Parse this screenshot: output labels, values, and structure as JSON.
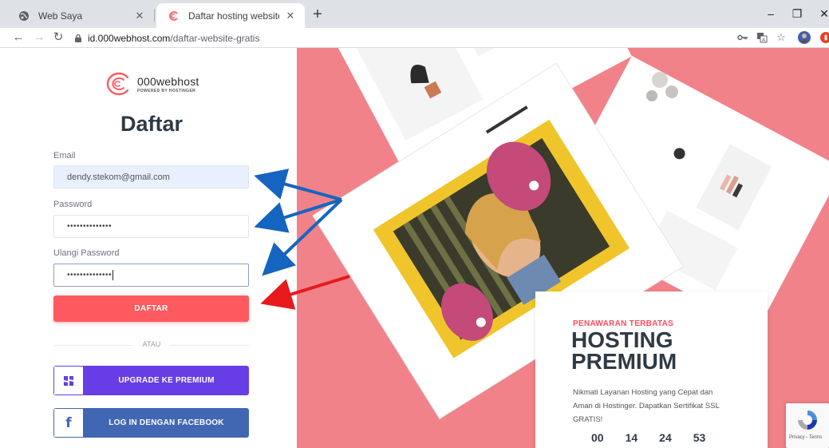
{
  "browser": {
    "tabs": [
      {
        "title": "Web Saya",
        "active": false
      },
      {
        "title": "Daftar hosting website gratis sek",
        "active": true
      }
    ],
    "url_host": "id.000webhost.com",
    "url_path": "/daftar-website-gratis"
  },
  "brand": {
    "name": "000webhost",
    "tagline": "POWERED BY HOSTINGER"
  },
  "form": {
    "title": "Daftar",
    "email_label": "Email",
    "email_value": "dendy.stekom@gmail.com",
    "password_label": "Password",
    "password_value": "••••••••••••••",
    "repeat_label": "Ulangi Password",
    "repeat_value": "••••••••••••••",
    "submit_label": "DAFTAR",
    "divider_text": "ATAU",
    "premium_label": "UPGRADE KE PREMIUM",
    "facebook_label": "LOG IN DENGAN FACEBOOK"
  },
  "promo": {
    "kicker": "PENAWARAN TERBATAS",
    "title_line1": "HOSTING",
    "title_line2": "PREMIUM",
    "description": "Nikmati Layanan Hosting yang Cepat dan Aman di Hostinger. Dapatkan Sertifikat SSL GRATIS!",
    "countdown": [
      "00",
      "14",
      "24",
      "53"
    ]
  },
  "recaptcha": {
    "links": "Privacy - Terms"
  },
  "colors": {
    "accent_red": "#ff5a5f",
    "premium_purple": "#673de6",
    "facebook_blue": "#4267b2",
    "hero_pink": "#f18289",
    "annotation_blue": "#1565c0",
    "annotation_red": "#e8191c"
  }
}
